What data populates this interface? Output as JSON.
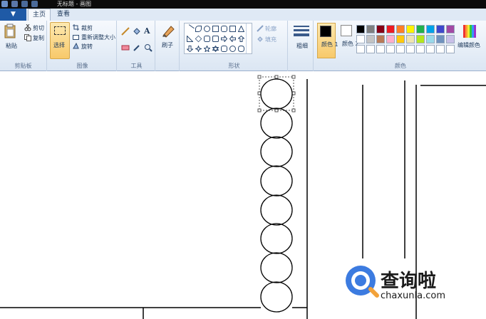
{
  "titlebar": {
    "title": "无标题 - 画图"
  },
  "menu": {
    "button_label": "▼"
  },
  "tabs": [
    {
      "label": "主页",
      "active": true
    },
    {
      "label": "查看",
      "active": false
    }
  ],
  "ribbon": {
    "clipboard": {
      "paste": "粘贴",
      "cut": "剪切",
      "copy": "复制",
      "group": "剪贴板"
    },
    "image": {
      "select": "选择",
      "crop": "裁剪",
      "resize": "重新调整大小",
      "rotate": "旋转",
      "group": "图像"
    },
    "tools": {
      "group": "工具"
    },
    "brushes": {
      "label": "刷子"
    },
    "shapes": {
      "outline": "轮廓",
      "fill": "填充",
      "group": "形状"
    },
    "size": {
      "label": "粗细"
    },
    "colors": {
      "color1": "颜色 1",
      "color2": "颜色 2",
      "edit": "编辑颜色",
      "group": "颜色",
      "color1_value": "#000000",
      "color2_value": "#ffffff",
      "palette_row1": [
        "#000000",
        "#7f7f7f",
        "#880015",
        "#ed1c24",
        "#ff7f27",
        "#fff200",
        "#22b14c",
        "#00a2e8",
        "#3f48cc",
        "#a349a4"
      ],
      "palette_row2": [
        "#ffffff",
        "#c3c3c3",
        "#b97a57",
        "#ffaec9",
        "#ffc90e",
        "#efe4b0",
        "#b5e61d",
        "#99d9ea",
        "#7092be",
        "#c8bfe7"
      ],
      "palette_row3": [
        "#ffffff",
        "#ffffff",
        "#ffffff",
        "#ffffff",
        "#ffffff",
        "#ffffff",
        "#ffffff",
        "#ffffff",
        "#ffffff",
        "#ffffff"
      ]
    }
  },
  "watermark": {
    "text": "查询啦",
    "url": "chaxunla.com"
  }
}
